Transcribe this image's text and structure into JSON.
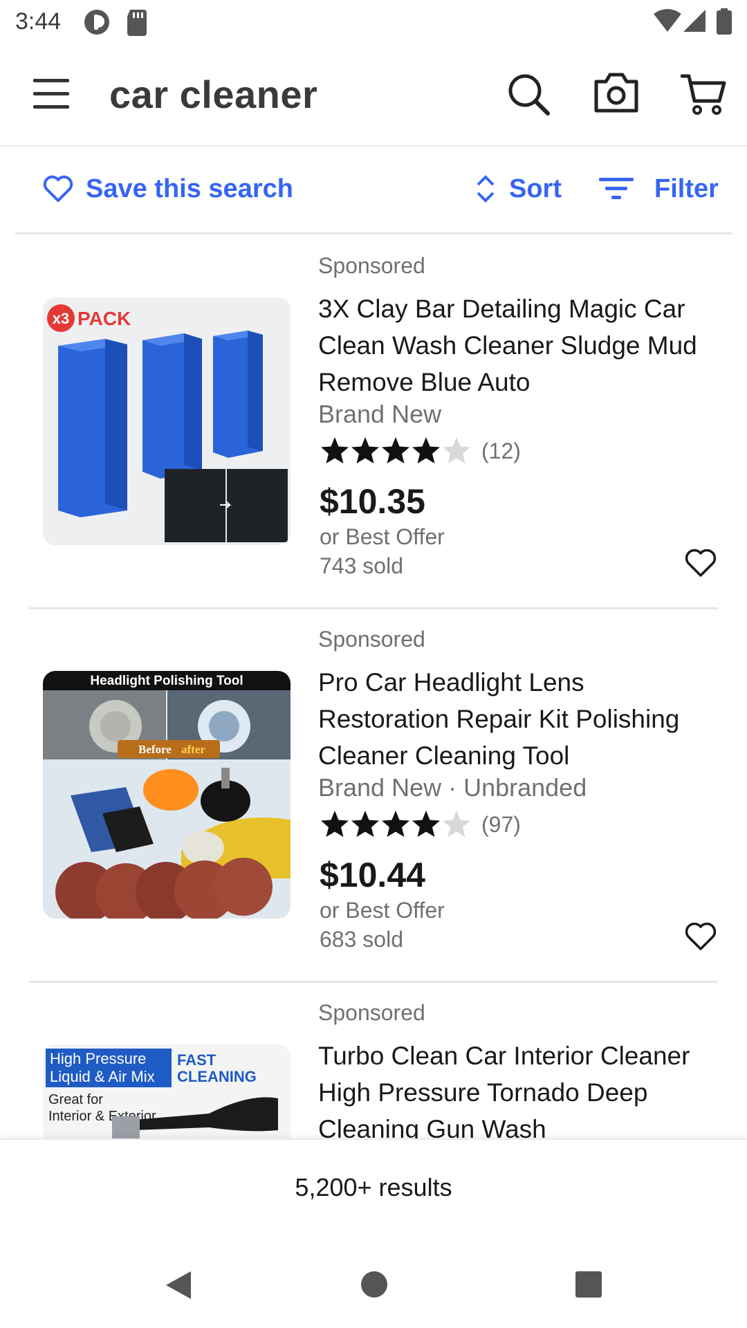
{
  "status_bar": {
    "time": "3:44"
  },
  "app_bar": {
    "query": "car cleaner"
  },
  "actions": {
    "save_search": "Save this search",
    "sort": "Sort",
    "filter": "Filter"
  },
  "items": [
    {
      "sponsored": "Sponsored",
      "title": "3X Clay Bar Detailing Magic Car Clean Wash Cleaner Sludge Mud Remove Blue Auto",
      "condition": "Brand New",
      "rating": 4,
      "review_count": "(12)",
      "price": "$10.35",
      "offer": "or Best Offer",
      "sold": "743 sold",
      "image_badge": "x3",
      "image_badge_text": "PACK"
    },
    {
      "sponsored": "Sponsored",
      "title": "Pro Car Headlight Lens Restoration Repair Kit Polishing Cleaner Cleaning Tool",
      "condition": "Brand New · Unbranded",
      "rating": 4,
      "review_count": "(97)",
      "price": "$10.44",
      "offer": "or Best Offer",
      "sold": "683 sold",
      "image_banner": "Headlight Polishing Tool",
      "image_before": "Before",
      "image_after": "after"
    },
    {
      "sponsored": "Sponsored",
      "title": "Turbo Clean Car Interior Cleaner High Pressure Tornado Deep Cleaning Gun Wash",
      "image_line1": "High Pressure",
      "image_line2": "Liquid & Air Mix",
      "image_fast": "FAST",
      "image_cleaning": "CLEANING",
      "image_great": "Great for",
      "image_interior": "Interior & Exterior"
    }
  ],
  "results": {
    "count_text": "5,200+ results"
  },
  "colors": {
    "accent": "#3665f3",
    "text": "#191919",
    "muted": "#707070"
  }
}
